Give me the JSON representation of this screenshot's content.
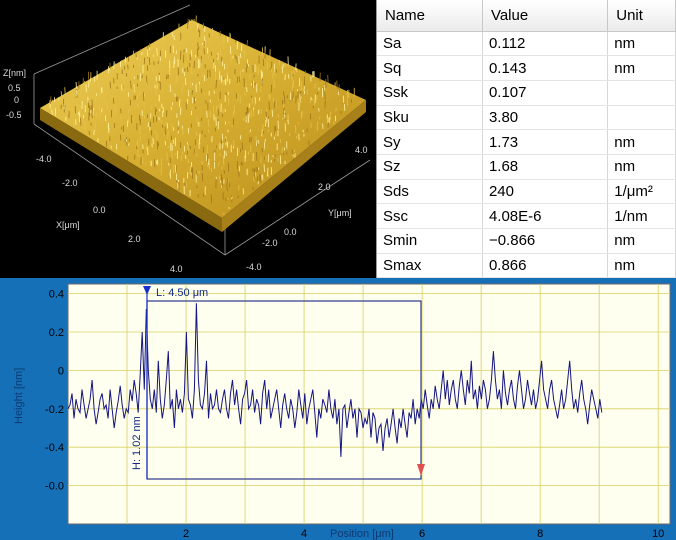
{
  "surface_view": {
    "z_axis_label": "Z[nm]",
    "z_ticks": [
      "0.5",
      "0",
      "-0.5"
    ],
    "x_axis_label": "X[μm]",
    "x_ticks": [
      "-4.0",
      "-2.0",
      "0.0",
      "2.0",
      "4.0"
    ],
    "y_axis_label": "Y[μm]",
    "y_ticks": [
      "4.0",
      "2.0",
      "0.0",
      "-2.0",
      "-4.0"
    ],
    "surface_color": "#d8b434"
  },
  "parameters": {
    "headers": {
      "name": "Name",
      "value": "Value",
      "unit": "Unit"
    },
    "rows": [
      {
        "name": "Sa",
        "value": "0.112",
        "unit": "nm"
      },
      {
        "name": "Sq",
        "value": "0.143",
        "unit": "nm"
      },
      {
        "name": "Ssk",
        "value": "0.107",
        "unit": ""
      },
      {
        "name": "Sku",
        "value": "3.80",
        "unit": ""
      },
      {
        "name": "Sy",
        "value": "1.73",
        "unit": "nm"
      },
      {
        "name": "Sz",
        "value": "1.68",
        "unit": "nm"
      },
      {
        "name": "Sds",
        "value": "240",
        "unit": "1/μm²"
      },
      {
        "name": "Ssc",
        "value": "4.08E-6",
        "unit": "1/nm"
      },
      {
        "name": "Smin",
        "value": "−0.866",
        "unit": "nm"
      },
      {
        "name": "Smax",
        "value": "0.866",
        "unit": "nm"
      }
    ]
  },
  "profile": {
    "ylabel": "Height [nm]",
    "xlabel": "Position [μm]",
    "x_ticks": [
      "2",
      "4",
      "6",
      "8",
      "10"
    ],
    "y_ticks": [
      "0.4",
      "0.2",
      "0",
      "-0.2",
      "-0.4",
      "-0.0"
    ],
    "length_label": "L: 4.50 μm",
    "height_label": "H: 1.02 nm",
    "line_color": "#151580",
    "plot_bg": "#fffff0",
    "grid_color": "#d8d060",
    "panel_bg": "#1570b8"
  },
  "chart_data": {
    "type": "line",
    "xlabel": "Position [μm]",
    "ylabel": "Height [nm]",
    "xlim": [
      0,
      10.2
    ],
    "ylim": [
      -0.8,
      0.45
    ],
    "x_start": 0,
    "x_step": 0.034,
    "series": [
      {
        "values": [
          -0.2,
          -0.18,
          -0.12,
          -0.25,
          -0.15,
          -0.2,
          -0.22,
          -0.1,
          -0.18,
          -0.25,
          -0.2,
          -0.15,
          -0.05,
          -0.2,
          -0.28,
          -0.22,
          -0.15,
          -0.12,
          -0.2,
          -0.18,
          -0.25,
          -0.1,
          -0.2,
          -0.3,
          -0.22,
          -0.16,
          -0.08,
          -0.18,
          -0.25,
          -0.2,
          -0.22,
          -0.1,
          -0.16,
          -0.05,
          -0.12,
          -0.22,
          -0.02,
          0.2,
          -0.1,
          0.32,
          0.0,
          -0.15,
          -0.2,
          -0.1,
          -0.22,
          0.05,
          -0.15,
          -0.25,
          -0.18,
          -0.05,
          0.1,
          -0.2,
          -0.15,
          -0.3,
          -0.1,
          -0.2,
          -0.15,
          -0.22,
          -0.12,
          0.2,
          -0.15,
          -0.18,
          -0.25,
          -0.1,
          0.35,
          -0.05,
          -0.18,
          -0.2,
          -0.12,
          0.05,
          -0.25,
          -0.12,
          -0.2,
          -0.18,
          -0.1,
          -0.2,
          -0.22,
          -0.15,
          -0.1,
          -0.2,
          -0.25,
          -0.12,
          -0.05,
          -0.18,
          -0.1,
          -0.2,
          -0.28,
          -0.15,
          -0.12,
          -0.05,
          -0.2,
          -0.18,
          -0.1,
          -0.22,
          -0.15,
          -0.18,
          -0.28,
          -0.12,
          -0.05,
          -0.2,
          -0.1,
          -0.25,
          -0.2,
          -0.15,
          -0.1,
          -0.2,
          -0.3,
          -0.18,
          -0.12,
          -0.2,
          -0.25,
          -0.15,
          -0.2,
          -0.3,
          -0.22,
          -0.1,
          -0.18,
          -0.25,
          -0.12,
          -0.28,
          -0.2,
          -0.15,
          -0.1,
          -0.22,
          -0.35,
          -0.2,
          -0.25,
          -0.15,
          -0.18,
          -0.22,
          -0.1,
          -0.2,
          -0.25,
          -0.15,
          -0.28,
          -0.2,
          -0.45,
          -0.2,
          -0.18,
          -0.3,
          -0.22,
          -0.15,
          -0.25,
          -0.2,
          -0.35,
          -0.2,
          -0.22,
          -0.3,
          -0.25,
          -0.28,
          -0.2,
          -0.35,
          -0.22,
          -0.25,
          -0.38,
          -0.3,
          -0.28,
          -0.42,
          -0.3,
          -0.25,
          -0.35,
          -0.28,
          -0.2,
          -0.3,
          -0.38,
          -0.25,
          -0.3,
          -0.2,
          -0.28,
          -0.35,
          -0.22,
          -0.25,
          -0.15,
          -0.28,
          -0.2,
          -0.25,
          -0.15,
          -0.2,
          -0.1,
          -0.18,
          -0.25,
          -0.15,
          -0.2,
          -0.08,
          -0.15,
          -0.2,
          -0.1,
          0.0,
          -0.15,
          -0.05,
          -0.18,
          -0.1,
          -0.05,
          -0.15,
          -0.2,
          -0.08,
          0.0,
          -0.1,
          -0.18,
          -0.05,
          -0.12,
          0.05,
          -0.15,
          -0.1,
          -0.2,
          -0.08,
          -0.15,
          -0.05,
          -0.1,
          -0.2,
          -0.15,
          -0.05,
          0.1,
          -0.05,
          -0.15,
          -0.1,
          -0.2,
          0.0,
          -0.12,
          -0.18,
          -0.1,
          -0.05,
          -0.15,
          -0.2,
          -0.08,
          0.0,
          -0.1,
          -0.2,
          -0.15,
          -0.05,
          -0.12,
          -0.18,
          -0.1,
          -0.2,
          -0.15,
          -0.05,
          0.05,
          -0.1,
          -0.15,
          -0.2,
          -0.1,
          -0.05,
          -0.15,
          -0.2,
          -0.25,
          -0.18,
          -0.1,
          -0.2,
          -0.15,
          -0.05,
          0.05,
          -0.1,
          -0.2,
          -0.15,
          -0.22,
          -0.12,
          -0.05,
          -0.15,
          -0.2,
          -0.28,
          -0.18,
          -0.1,
          -0.15,
          -0.2,
          -0.25,
          -0.15,
          -0.22
        ]
      }
    ]
  }
}
